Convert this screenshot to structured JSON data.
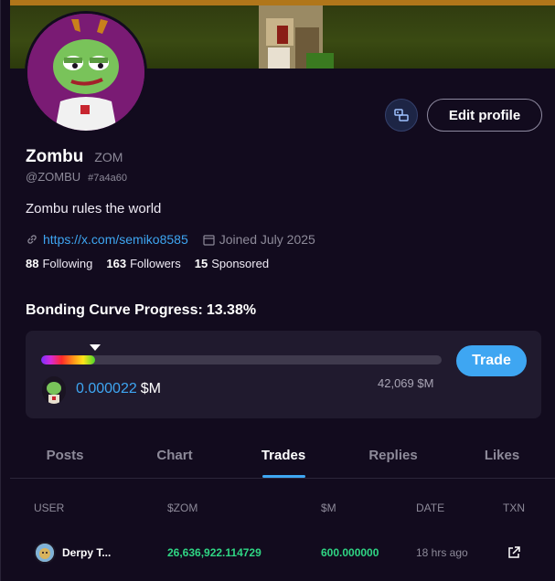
{
  "profile": {
    "name": "Zombu",
    "ticker": "ZOM",
    "handle": "@ZOMBU",
    "hash": "#7a4a60",
    "bio": "Zombu rules the world",
    "link": "https://x.com/semiko8585",
    "joined": "Joined July 2025"
  },
  "actions": {
    "edit_profile": "Edit profile",
    "trade": "Trade",
    "wallet_icon": "wallet-link-icon"
  },
  "stats": {
    "following_count": "88",
    "following_label": "Following",
    "followers_count": "163",
    "followers_label": "Followers",
    "sponsored_count": "15",
    "sponsored_label": "Sponsored"
  },
  "bonding_curve": {
    "title": "Bonding Curve Progress:",
    "value_text": "13.38%",
    "progress_fraction": 0.1338,
    "price": "0.000022",
    "price_unit": "$M",
    "market_cap": "42,069 $M"
  },
  "tabs": [
    {
      "label": "Posts",
      "active": false
    },
    {
      "label": "Chart",
      "active": false
    },
    {
      "label": "Trades",
      "active": true
    },
    {
      "label": "Replies",
      "active": false
    },
    {
      "label": "Likes",
      "active": false
    }
  ],
  "table": {
    "headers": [
      "USER",
      "$ZOM",
      "$M",
      "DATE",
      "TXN"
    ],
    "rows": [
      {
        "user": "Derpy T...",
        "zom": "26,636,922.114729",
        "m": "600.000000",
        "date": "18 hrs ago",
        "txn_icon": "external-link-icon"
      }
    ]
  },
  "colors": {
    "accent": "#3ea6f2",
    "positive": "#2fd684",
    "background": "#120b1e",
    "card": "#201a2e"
  }
}
